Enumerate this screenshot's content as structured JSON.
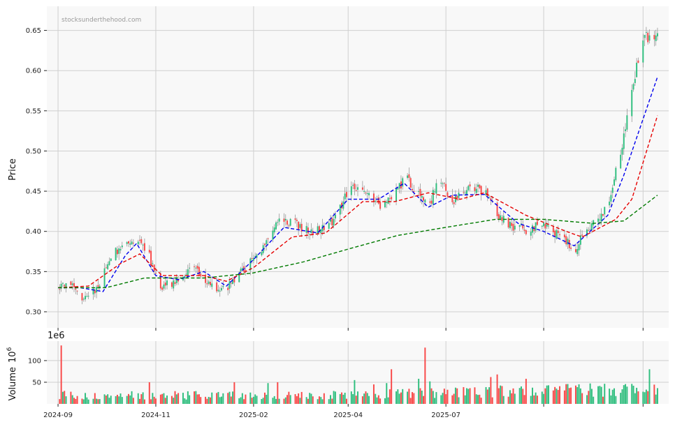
{
  "watermark": "stocksunderthehood.com",
  "colors": {
    "up": "#2fbe7e",
    "down": "#f94848",
    "ma_short": "#0000ee",
    "ma_mid": "#e60000",
    "ma_long": "#007a00",
    "grid": "#cfcfcf",
    "panel": "#f8f8f8"
  },
  "chart_data": [
    {
      "type": "candlestick",
      "ylabel": "Price",
      "xlabel": "",
      "ylim": [
        0.28,
        0.68
      ],
      "yticks": [
        0.3,
        0.35,
        0.4,
        0.45,
        0.5,
        0.55,
        0.6,
        0.65
      ],
      "ytick_labels": [
        "0.30",
        "0.35",
        "0.40",
        "0.45",
        "0.50",
        "0.55",
        "0.60",
        "0.65"
      ],
      "xlim": [
        "2024-08-25",
        "2025-09-17"
      ],
      "xticks": [
        "2024-09-01",
        "2024-11-01",
        "2025-01-01",
        "2025-03-01",
        "2025-05-01",
        "2025-07-01",
        "2025-09-01"
      ],
      "grid": true,
      "price_anchors": [
        [
          "2024-09-01",
          0.33
        ],
        [
          "2024-09-08",
          0.335
        ],
        [
          "2024-09-15",
          0.318
        ],
        [
          "2024-09-22",
          0.32
        ],
        [
          "2024-09-29",
          0.345
        ],
        [
          "2024-10-06",
          0.372
        ],
        [
          "2024-10-13",
          0.388
        ],
        [
          "2024-10-20",
          0.392
        ],
        [
          "2024-10-27",
          0.375
        ],
        [
          "2024-11-03",
          0.33
        ],
        [
          "2024-11-10",
          0.335
        ],
        [
          "2024-11-17",
          0.345
        ],
        [
          "2024-11-24",
          0.355
        ],
        [
          "2024-12-01",
          0.34
        ],
        [
          "2024-12-08",
          0.328
        ],
        [
          "2024-12-15",
          0.33
        ],
        [
          "2024-12-22",
          0.345
        ],
        [
          "2024-12-29",
          0.36
        ],
        [
          "2025-01-05",
          0.375
        ],
        [
          "2025-01-12",
          0.4
        ],
        [
          "2025-01-19",
          0.415
        ],
        [
          "2025-01-26",
          0.41
        ],
        [
          "2025-02-02",
          0.402
        ],
        [
          "2025-02-09",
          0.4
        ],
        [
          "2025-02-16",
          0.405
        ],
        [
          "2025-02-23",
          0.425
        ],
        [
          "2025-03-02",
          0.455
        ],
        [
          "2025-03-09",
          0.45
        ],
        [
          "2025-03-16",
          0.44
        ],
        [
          "2025-03-23",
          0.43
        ],
        [
          "2025-03-30",
          0.445
        ],
        [
          "2025-04-06",
          0.47
        ],
        [
          "2025-04-13",
          0.448
        ],
        [
          "2025-04-20",
          0.428
        ],
        [
          "2025-04-27",
          0.47
        ],
        [
          "2025-05-04",
          0.435
        ],
        [
          "2025-05-11",
          0.445
        ],
        [
          "2025-05-18",
          0.455
        ],
        [
          "2025-05-25",
          0.45
        ],
        [
          "2025-06-01",
          0.425
        ],
        [
          "2025-06-08",
          0.41
        ],
        [
          "2025-06-15",
          0.405
        ],
        [
          "2025-06-22",
          0.4
        ],
        [
          "2025-06-29",
          0.41
        ],
        [
          "2025-07-06",
          0.4
        ],
        [
          "2025-07-13",
          0.395
        ],
        [
          "2025-07-20",
          0.375
        ],
        [
          "2025-07-27",
          0.4
        ],
        [
          "2025-08-03",
          0.415
        ],
        [
          "2025-08-10",
          0.43
        ],
        [
          "2025-08-17",
          0.49
        ],
        [
          "2025-08-24",
          0.56
        ],
        [
          "2025-08-31",
          0.64
        ]
      ],
      "series": [
        {
          "name": "",
          "role": "moving-average-short",
          "color": "#0000ee",
          "style": "dashed",
          "points": [
            [
              "2024-09-01",
              0.33
            ],
            [
              "2024-09-15",
              0.33
            ],
            [
              "2024-09-29",
              0.325
            ],
            [
              "2024-10-13",
              0.37
            ],
            [
              "2024-10-20",
              0.385
            ],
            [
              "2024-11-01",
              0.345
            ],
            [
              "2024-11-15",
              0.34
            ],
            [
              "2024-12-01",
              0.35
            ],
            [
              "2024-12-15",
              0.332
            ],
            [
              "2025-01-01",
              0.365
            ],
            [
              "2025-01-20",
              0.405
            ],
            [
              "2025-02-10",
              0.398
            ],
            [
              "2025-03-01",
              0.44
            ],
            [
              "2025-03-20",
              0.44
            ],
            [
              "2025-04-05",
              0.46
            ],
            [
              "2025-04-20",
              0.43
            ],
            [
              "2025-05-05",
              0.445
            ],
            [
              "2025-05-25",
              0.446
            ],
            [
              "2025-06-15",
              0.41
            ],
            [
              "2025-07-01",
              0.4
            ],
            [
              "2025-07-20",
              0.382
            ],
            [
              "2025-08-10",
              0.42
            ],
            [
              "2025-08-20",
              0.47
            ],
            [
              "2025-09-10",
              0.592
            ]
          ]
        },
        {
          "name": "",
          "role": "moving-average-mid",
          "color": "#e60000",
          "style": "dashed",
          "points": [
            [
              "2024-09-01",
              0.33
            ],
            [
              "2024-09-20",
              0.332
            ],
            [
              "2024-10-10",
              0.36
            ],
            [
              "2024-10-22",
              0.372
            ],
            [
              "2024-11-05",
              0.345
            ],
            [
              "2024-12-01",
              0.345
            ],
            [
              "2024-12-15",
              0.338
            ],
            [
              "2025-01-01",
              0.355
            ],
            [
              "2025-01-25",
              0.393
            ],
            [
              "2025-02-15",
              0.398
            ],
            [
              "2025-03-10",
              0.437
            ],
            [
              "2025-03-30",
              0.437
            ],
            [
              "2025-04-20",
              0.448
            ],
            [
              "2025-05-10",
              0.44
            ],
            [
              "2025-05-25",
              0.448
            ],
            [
              "2025-06-20",
              0.42
            ],
            [
              "2025-07-15",
              0.4
            ],
            [
              "2025-07-25",
              0.393
            ],
            [
              "2025-08-15",
              0.415
            ],
            [
              "2025-08-25",
              0.44
            ],
            [
              "2025-09-10",
              0.544
            ]
          ]
        },
        {
          "name": "",
          "role": "moving-average-long",
          "color": "#007a00",
          "style": "dashed",
          "points": [
            [
              "2024-09-01",
              0.33
            ],
            [
              "2024-10-01",
              0.33
            ],
            [
              "2024-10-25",
              0.342
            ],
            [
              "2024-12-01",
              0.342
            ],
            [
              "2024-12-31",
              0.348
            ],
            [
              "2025-02-01",
              0.362
            ],
            [
              "2025-03-01",
              0.378
            ],
            [
              "2025-04-01",
              0.395
            ],
            [
              "2025-05-01",
              0.405
            ],
            [
              "2025-06-01",
              0.415
            ],
            [
              "2025-07-01",
              0.415
            ],
            [
              "2025-08-01",
              0.41
            ],
            [
              "2025-08-20",
              0.413
            ],
            [
              "2025-09-10",
              0.445
            ]
          ]
        }
      ]
    },
    {
      "type": "bar",
      "ylabel": "Volume",
      "ylabel_unit": "10",
      "ylabel_unit_exp": "6",
      "multiplier_base": "1e",
      "multiplier_exp": "6",
      "ylim": [
        0,
        145
      ],
      "yticks": [
        50,
        100
      ],
      "ytick_labels": [
        "50",
        "100"
      ],
      "grid": true,
      "baseline_volume": 22,
      "volume_spikes": [
        [
          "2024-09-03",
          135,
          "down"
        ],
        [
          "2024-09-05",
          30,
          "down"
        ],
        [
          "2024-10-28",
          50,
          "down"
        ],
        [
          "2024-12-20",
          50,
          "down"
        ],
        [
          "2025-01-10",
          48,
          "up"
        ],
        [
          "2025-01-16",
          50,
          "down"
        ],
        [
          "2025-03-05",
          55,
          "up"
        ],
        [
          "2025-03-17",
          45,
          "down"
        ],
        [
          "2025-03-25",
          48,
          "up"
        ],
        [
          "2025-03-28",
          80,
          "down"
        ],
        [
          "2025-04-14",
          58,
          "up"
        ],
        [
          "2025-04-18",
          130,
          "down"
        ],
        [
          "2025-04-21",
          52,
          "up"
        ],
        [
          "2025-05-10",
          60,
          "down"
        ],
        [
          "2025-05-29",
          62,
          "down"
        ],
        [
          "2025-06-02",
          68,
          "down"
        ],
        [
          "2025-06-20",
          58,
          "down"
        ],
        [
          "2025-08-30",
          90,
          "up"
        ],
        [
          "2025-09-05",
          80,
          "up"
        ]
      ],
      "x_tick_labels": [
        "2024-09",
        "2024-11",
        "2025-02",
        "2025-04",
        "2025-07"
      ]
    }
  ]
}
